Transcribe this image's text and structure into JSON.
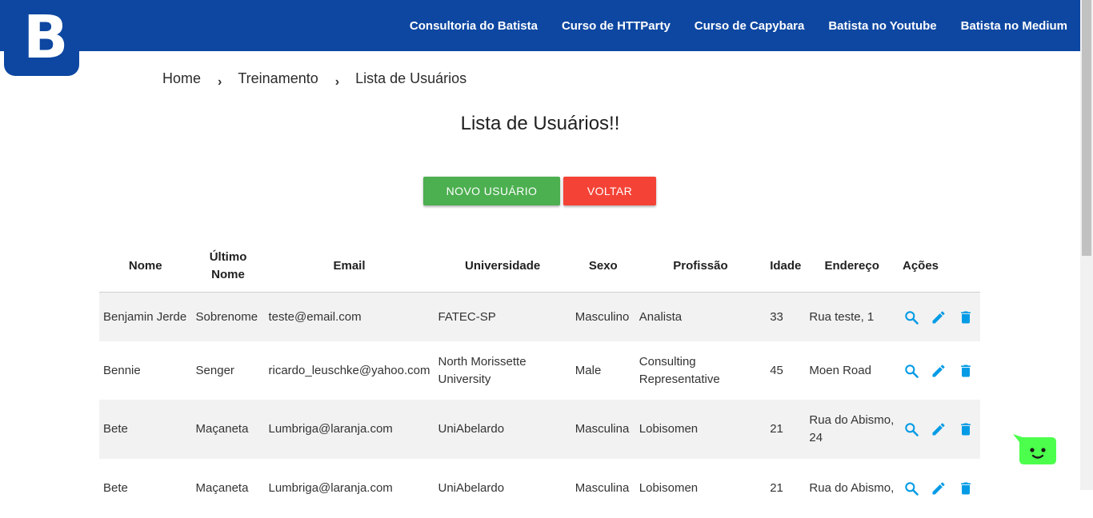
{
  "brand": {
    "logo_letter": "B"
  },
  "nav": {
    "links": [
      "Consultoria do Batista",
      "Curso de HTTParty",
      "Curso de Capybara",
      "Batista no Youtube",
      "Batista no Medium"
    ]
  },
  "breadcrumb": {
    "home": "Home",
    "sep": "›",
    "training": "Treinamento",
    "current": "Lista de Usuários"
  },
  "page": {
    "title": "Lista de Usuários!!"
  },
  "buttons": {
    "new_user": "NOVO USUÁRIO",
    "back": "VOLTAR"
  },
  "table": {
    "headers": {
      "nome": "Nome",
      "ultimo_nome_l1": "Último",
      "ultimo_nome_l2": "Nome",
      "email": "Email",
      "universidade": "Universidade",
      "sexo": "Sexo",
      "profissao": "Profissão",
      "idade": "Idade",
      "endereco": "Endereço",
      "acoes": "Ações"
    },
    "rows": [
      {
        "nome": "Benjamin Jerde",
        "ultimo": "Sobrenome",
        "email": "teste@email.com",
        "universidade": "FATEC-SP",
        "sexo": "Masculino",
        "profissao": "Analista",
        "idade": "33",
        "endereco": "Rua teste, 1"
      },
      {
        "nome": "Bennie",
        "ultimo": "Senger",
        "email": "ricardo_leuschke@yahoo.com",
        "universidade": "North Morissette University",
        "sexo": "Male",
        "profissao": "Consulting Representative",
        "idade": "45",
        "endereco": "Moen Road"
      },
      {
        "nome": "Bete",
        "ultimo": "Maçaneta",
        "email": "Lumbriga@laranja.com",
        "universidade": "UniAbelardo",
        "sexo": "Masculina",
        "profissao": "Lobisomen",
        "idade": "21",
        "endereco": "Rua do Abismo, 24"
      },
      {
        "nome": "Bete",
        "ultimo": "Maçaneta",
        "email": "Lumbriga@laranja.com",
        "universidade": "UniAbelardo",
        "sexo": "Masculina",
        "profissao": "Lobisomen",
        "idade": "21",
        "endereco": "Rua do Abismo,"
      }
    ]
  },
  "colors": {
    "nav_bg": "#0d47a1",
    "btn_new": "#4caf50",
    "btn_back": "#f44336",
    "action_icon": "#039be5",
    "row_stripe": "#f2f2f2",
    "chat_bot": "#4cff4c"
  },
  "icons": {
    "view": "search-icon",
    "edit": "pencil-icon",
    "delete": "trash-icon",
    "chat": "chat-bot-icon"
  }
}
